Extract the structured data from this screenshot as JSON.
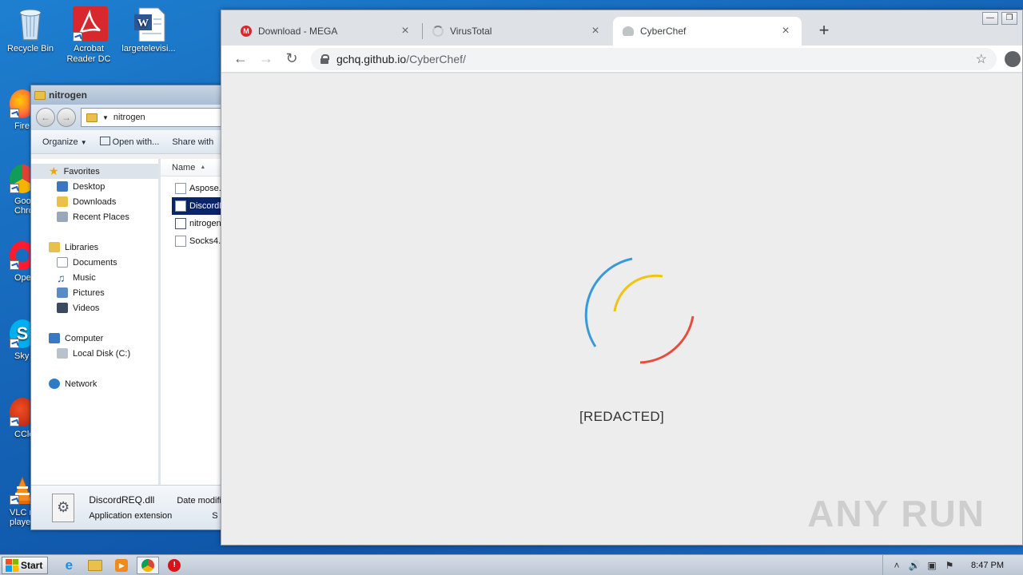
{
  "desktop": {
    "icons": [
      {
        "label": "Recycle Bin"
      },
      {
        "label": "Acrobat Reader DC"
      },
      {
        "label": "largetelevisi..."
      }
    ],
    "side_icons": [
      {
        "label": "Fire"
      },
      {
        "label": "Goo Chro"
      },
      {
        "label": "Ope"
      },
      {
        "label": "Sky"
      },
      {
        "label": "CCle"
      },
      {
        "label": "VLC m player"
      }
    ]
  },
  "explorer": {
    "title": "nitrogen",
    "address": "nitrogen",
    "toolbar": {
      "organize": "Organize",
      "open_with": "Open with...",
      "share_with": "Share with"
    },
    "nav": {
      "favorites": "Favorites",
      "desktop": "Desktop",
      "downloads": "Downloads",
      "recent": "Recent Places",
      "libraries": "Libraries",
      "documents": "Documents",
      "music": "Music",
      "pictures": "Pictures",
      "videos": "Videos",
      "computer": "Computer",
      "local_disk": "Local Disk (C:)",
      "network": "Network"
    },
    "column_name": "Name",
    "files": [
      "Aspose.",
      "DiscordR",
      "nitrogen",
      "Socks4."
    ],
    "status": {
      "filename": "DiscordREQ.dll",
      "date_label": "Date modifi",
      "type": "Application extension",
      "size_label": "S"
    }
  },
  "browser": {
    "tabs": [
      {
        "title": "Download - MEGA"
      },
      {
        "title": "VirusTotal"
      },
      {
        "title": "CyberChef"
      }
    ],
    "url_host": "gchq.github.io",
    "url_path": "/CyberChef/",
    "page_text": "[REDACTED]",
    "watermark": "ANY RUN"
  },
  "taskbar": {
    "start_label": "Start",
    "clock": "8:47 PM"
  }
}
